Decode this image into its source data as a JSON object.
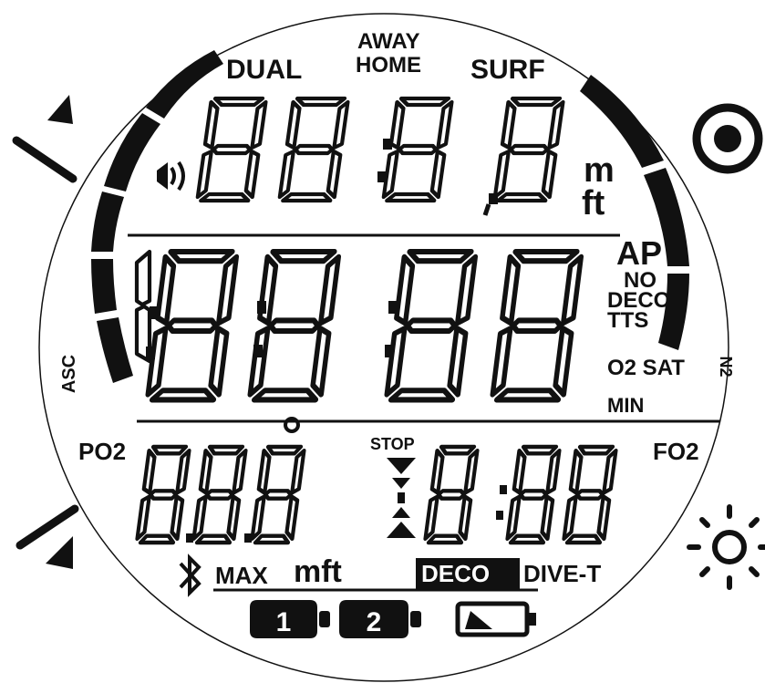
{
  "labels": {
    "dual": "DUAL",
    "away": "AWAY",
    "home": "HOME",
    "surf": "SURF",
    "unit_m": "m",
    "unit_ft": "ft",
    "ap": "AP",
    "no": "NO",
    "deco": "DECO",
    "tts": "TTS",
    "o2sat": "O2 SAT",
    "n2": "N2",
    "min": "MIN",
    "asc": "ASC",
    "po2": "PO2",
    "stop": "STOP",
    "fo2": "FO2",
    "max": "MAX",
    "mft": "mft",
    "deco_badge": "DECO",
    "dive_t": "DIVE-T",
    "tank1": "1",
    "tank2": "2"
  },
  "icons": {
    "up_button": "triangle-up-icon",
    "down_button": "triangle-down-icon",
    "select_button": "target-button-icon",
    "backlight_button": "sun-icon",
    "sound": "sound-wave-icon",
    "bluetooth": "bluetooth-icon",
    "battery": "battery-icon",
    "ascent_bar": "ascent-bar-icon",
    "stop_arrows": "hourglass-arrows-icon"
  },
  "colors": {
    "ink": "#111111",
    "background": "#ffffff"
  }
}
